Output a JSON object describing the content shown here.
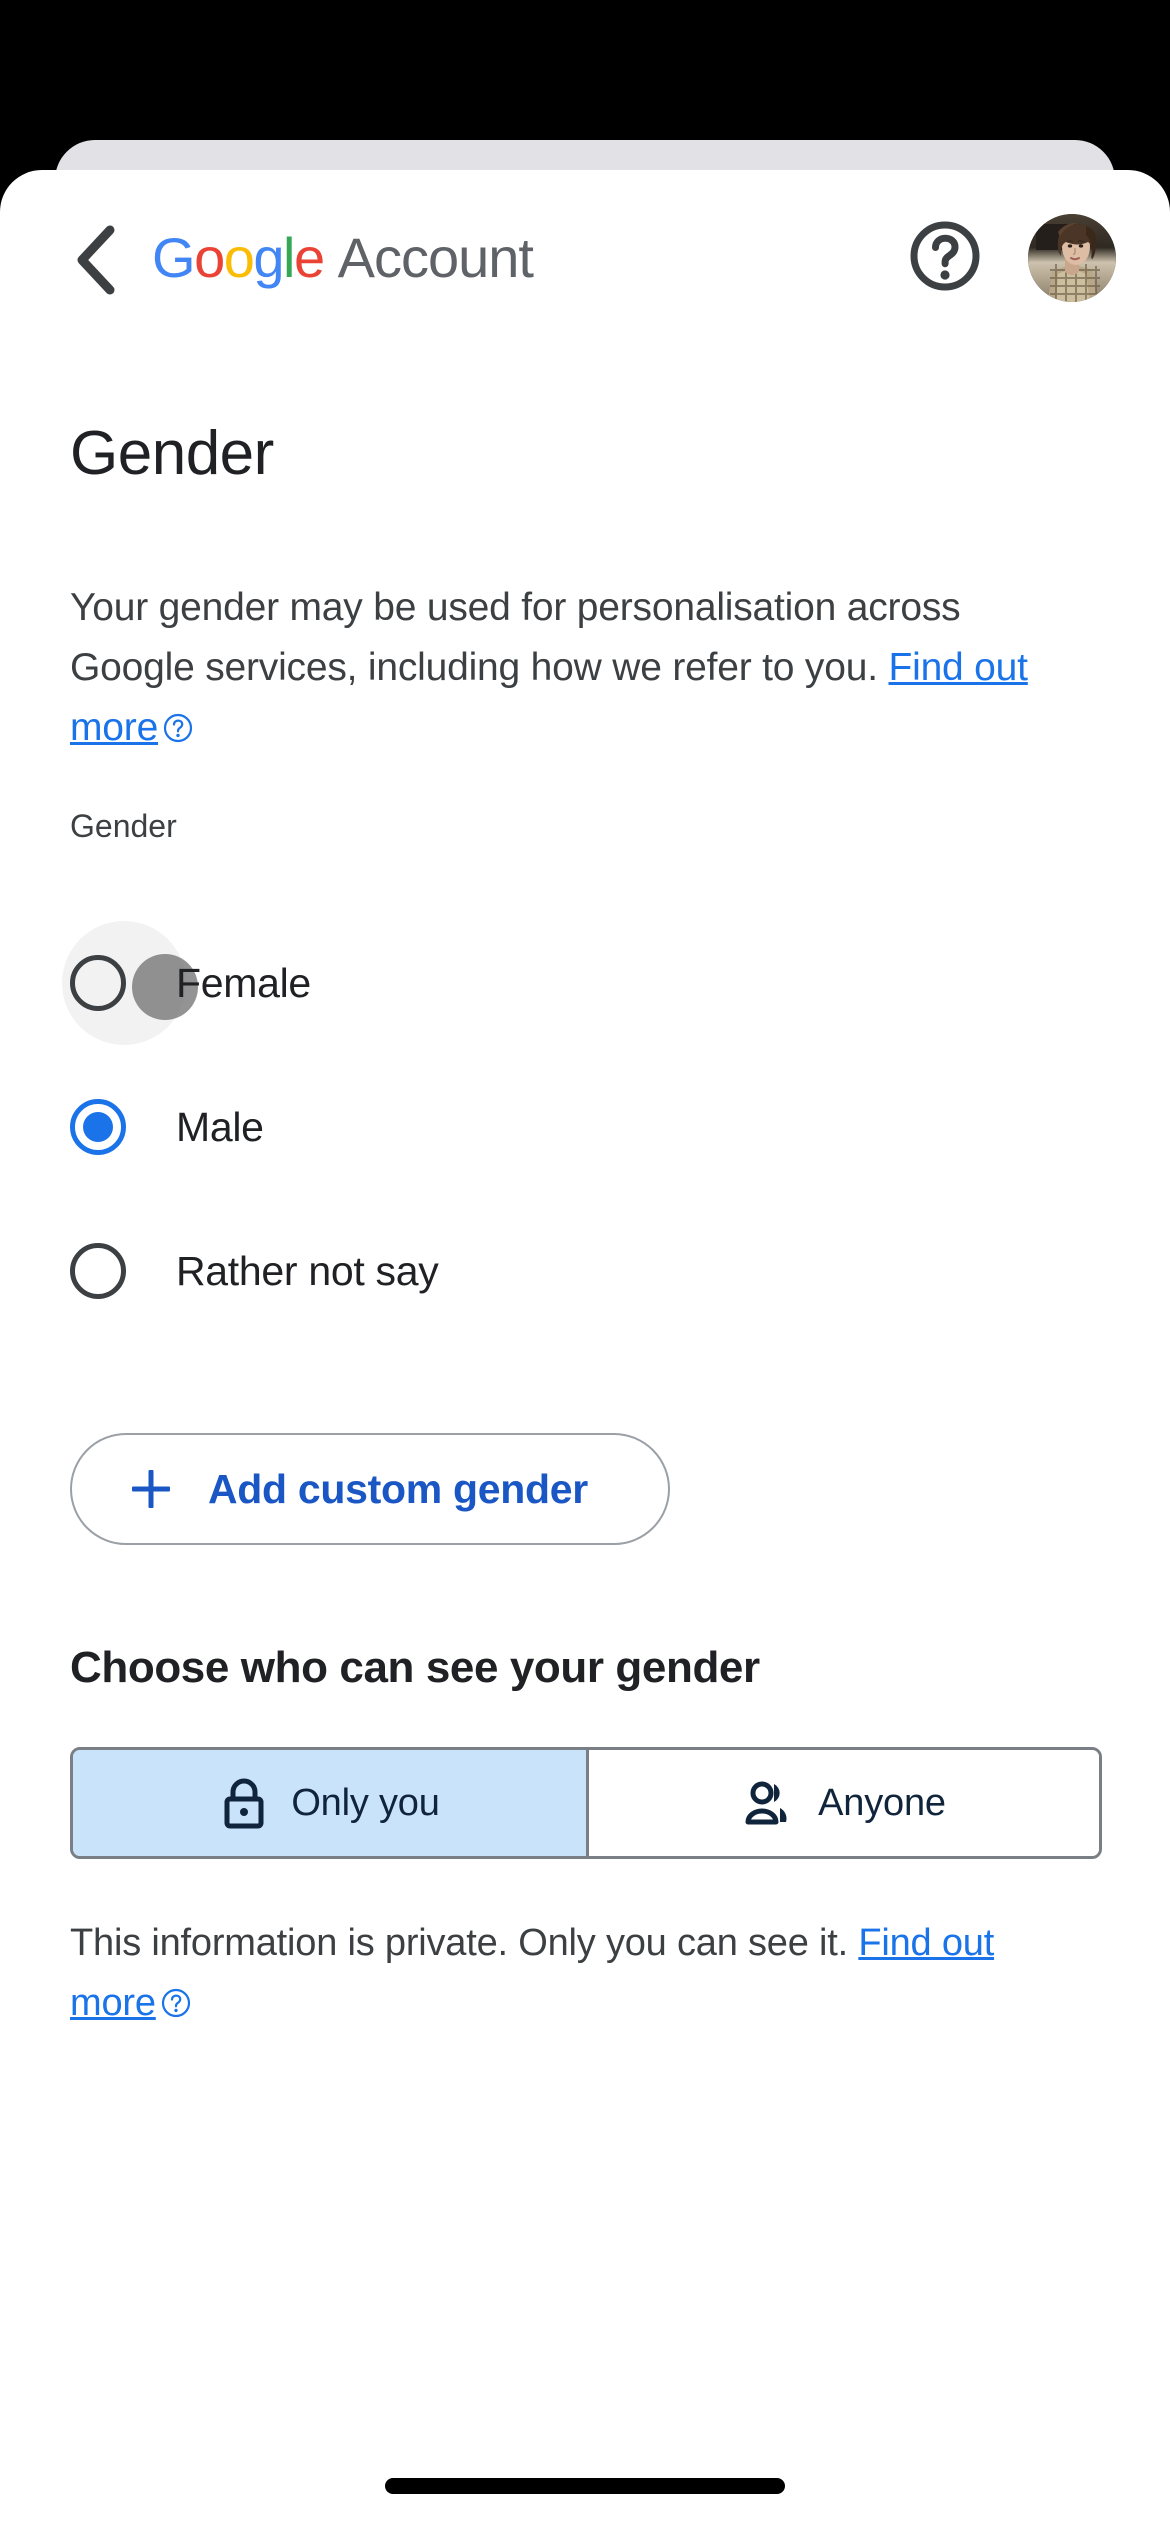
{
  "header": {
    "back_icon": "chevron-left-icon",
    "brand_google": "Google",
    "brand_google_letters": [
      "G",
      "o",
      "o",
      "g",
      "l",
      "e"
    ],
    "brand_suffix": "Account",
    "help_icon": "help-circle-icon",
    "avatar_icon": "user-avatar-photo"
  },
  "page": {
    "title": "Gender",
    "description_part1": "Your gender may be used for personalisation across Google services, including how we refer to you. ",
    "description_link": "Find out more",
    "description_link_icon": "help-circle-small-icon",
    "field_label": "Gender"
  },
  "options": [
    {
      "label": "Female",
      "selected": false,
      "has_touch_indicator": true
    },
    {
      "label": "Male",
      "selected": true,
      "has_touch_indicator": false
    },
    {
      "label": "Rather not say",
      "selected": false,
      "has_touch_indicator": false
    }
  ],
  "add_custom": {
    "icon": "plus-icon",
    "label": "Add custom gender"
  },
  "visibility": {
    "heading": "Choose who can see your gender",
    "segments": [
      {
        "label": "Only you",
        "icon": "lock-icon",
        "selected": true
      },
      {
        "label": "Anyone",
        "icon": "people-icon",
        "selected": false
      }
    ],
    "footnote_part1": "This information is private. Only you can see it. ",
    "footnote_link": "Find out more",
    "footnote_link_icon": "help-circle-small-icon"
  },
  "colors": {
    "google_blue": "#4285F4",
    "google_red": "#EA4335",
    "google_yellow": "#FBBC05",
    "google_green": "#34A853",
    "link_blue": "#1a73e8",
    "selected_segment_bg": "#c9e3fa",
    "text_primary": "#202124",
    "text_secondary": "#3c4043"
  }
}
